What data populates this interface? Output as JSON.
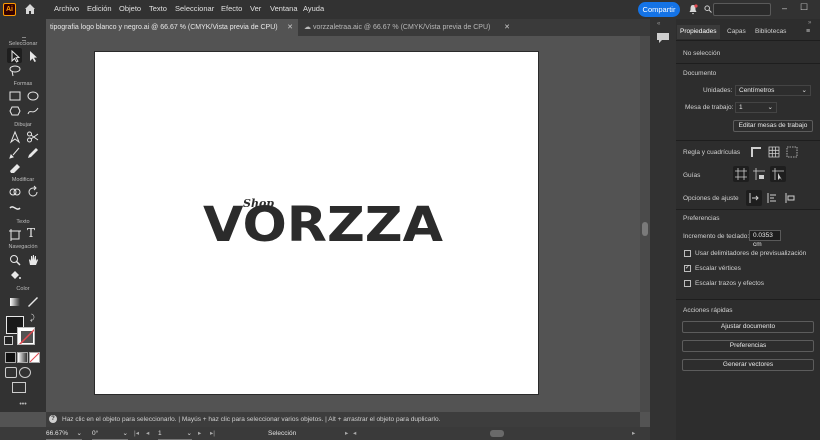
{
  "app": {
    "logo": "Ai"
  },
  "menu": [
    "Archivo",
    "Edición",
    "Objeto",
    "Texto",
    "Seleccionar",
    "Efecto",
    "Ver",
    "Ventana",
    "Ayuda"
  ],
  "header": {
    "share_label": "Compartir"
  },
  "tabs": [
    {
      "label": "tipografia logo blanco y negro.ai @ 66.67 % (CMYK/Vista previa de CPU)"
    },
    {
      "label": "vorzzaletraa.aic @ 66.67 % (CMYK/Vista previa de CPU)"
    }
  ],
  "toolbar": {
    "groups": [
      "Seleccionar",
      "Formas",
      "Dibujar",
      "Modificar",
      "Texto",
      "Navegación",
      "Color"
    ],
    "more": "•••"
  },
  "canvas": {
    "logo_text": "VORZZA",
    "logo_sub": "Shop"
  },
  "status": {
    "hint": "Haz clic en el objeto para seleccionarlo.  |  Mayús + haz clic para seleccionar varios objetos.  |  Alt + arrastrar el objeto para duplicarlo."
  },
  "bottom": {
    "zoom": "66.67%",
    "rotation": "0°",
    "artboard": "1",
    "tool": "Selección"
  },
  "panel": {
    "tabs": [
      "Propiedades",
      "Capas",
      "Bibliotecas"
    ],
    "no_selection": "No selección",
    "document": "Documento",
    "units_label": "Unidades:",
    "units_value": "Centímetros",
    "artboard_label": "Mesa de trabajo:",
    "artboard_value": "1",
    "edit_artboards": "Editar mesas de trabajo",
    "rulers": "Regla y cuadrículas",
    "guides": "Guías",
    "snap": "Opciones de ajuste",
    "preferences": "Preferencias",
    "keyboard_inc_label": "Incremento de teclado:",
    "keyboard_inc_value": "0.0353 cm",
    "cb1": "Usar delimitadores de previsualización",
    "cb2": "Escalar vértices",
    "cb3": "Escalar trazos y efectos",
    "quick_actions": "Acciones rápidas",
    "btn_fit": "Ajustar documento",
    "btn_prefs": "Preferencias",
    "btn_vectors": "Generar vectores"
  },
  "colors": {
    "accent": "#1473e6",
    "brand": "#ff9a00",
    "logo": "#2b2b2b"
  }
}
